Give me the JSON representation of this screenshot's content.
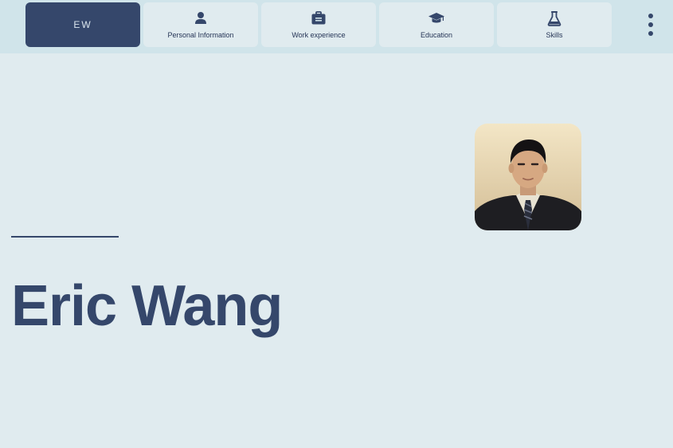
{
  "brand": {
    "initials": "EW"
  },
  "nav": {
    "tabs": [
      {
        "label": "Personal Information",
        "icon": "person-icon"
      },
      {
        "label": "Work experience",
        "icon": "briefcase-icon"
      },
      {
        "label": "Education",
        "icon": "graduation-cap-icon"
      },
      {
        "label": "Skills",
        "icon": "flask-icon"
      }
    ]
  },
  "menu": {
    "icon": "kebab-menu-icon"
  },
  "hero": {
    "name": "Eric Wang",
    "avatar": "profile-photo"
  },
  "colors": {
    "background": "#e0ebef",
    "topbar": "#d0e4ea",
    "accent": "#35476b",
    "tab_text": "#253456"
  }
}
